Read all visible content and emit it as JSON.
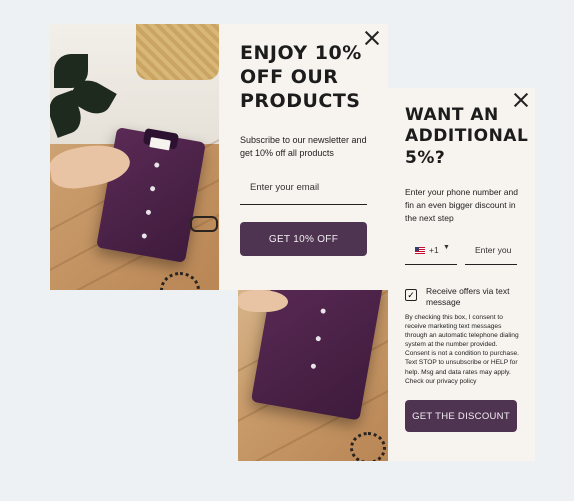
{
  "popup1": {
    "heading": "ENJOY 10%\nOFF OUR\nPRODUCTS",
    "subtext": "Subscribe to our newsletter and get 10% off all products",
    "email_placeholder": "Enter your email",
    "cta_label": "GET 10% OFF",
    "close_icon": "close-icon"
  },
  "popup2": {
    "heading": "WANT AN\nADDITIONAL\n5%?",
    "subtext": "Enter your phone number and fin an  even bigger discount in the next step",
    "country_code": "+1",
    "country_flag": "us-flag-icon",
    "phone_placeholder": "Enter you",
    "checkbox_label": "Receive offers via text message",
    "checkbox_checked": true,
    "consent_text": "By checking this box, I consent to receive marketing text messages through an automatic telephone dialing system at the number provided. Consent is not a condition to purchase. Text STOP to unsubscribe or HELP for help. Msg and data rates may apply. Check our privacy policy",
    "cta_label": "GET THE DISCOUNT",
    "close_icon": "close-icon"
  },
  "colors": {
    "background": "#eef1f3",
    "panel": "#f7f4ef",
    "cta": "#4f3452",
    "shirt": "#4a2147"
  }
}
